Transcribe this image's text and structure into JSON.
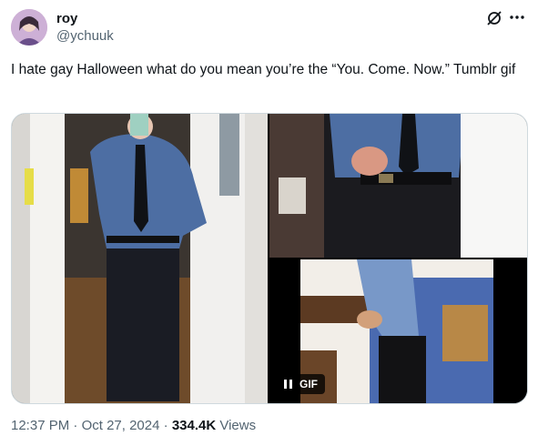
{
  "author": {
    "name": "roy",
    "handle": "@ychuuk"
  },
  "tweet": {
    "text": "I hate gay Halloween what do you mean you’re the “You. Come. Now.” Tumblr gif"
  },
  "media": {
    "gif_label": "GIF"
  },
  "meta": {
    "time": "12:37 PM",
    "separator1": " · ",
    "date": "Oct 27, 2024",
    "separator2": " · ",
    "views_count": "334.4K",
    "views_label": " Views"
  },
  "icons": {
    "grok": "grok-icon",
    "more": "more-icon",
    "pause": "pause-icon"
  },
  "colors": {
    "text": "#0f1419",
    "secondary": "#536471",
    "border": "#cfd9de"
  }
}
